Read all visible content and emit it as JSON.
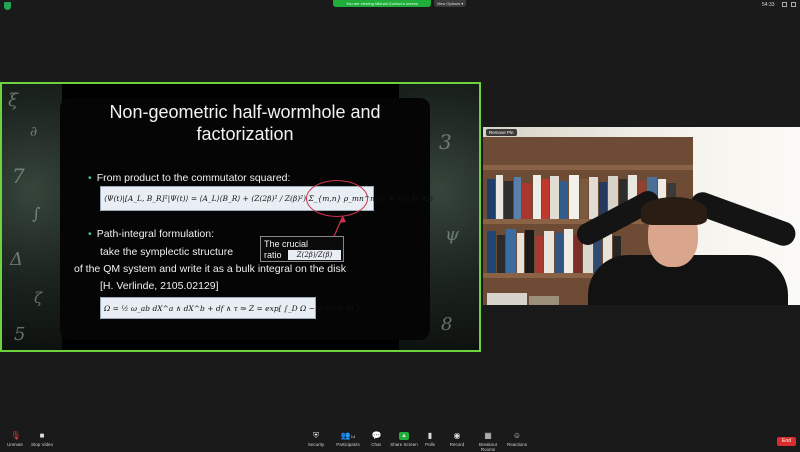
{
  "topbar": {
    "share_banner": "You are viewing Mikhail Gulinov's screen",
    "view_options": "View Options ▾",
    "clock": "54:33"
  },
  "slide": {
    "title_line1": "Non-geometric half-wormhole and",
    "title_line2": "factorization",
    "bullet1": "From product to the commutator squared:",
    "formula1": "⟨Ψ(t)|[A_L, B_R]²|Ψ(t)⟩ = ⟨A_L⟩⟨B_R⟩ + (Z(2β)² / Z(β)²) Σ_{m,n} ρ_mn^max A_mn B_mn",
    "bullet2": "Path-integral formulation:",
    "line2a": "take the symplectic structure",
    "line2b": "of the QM system and write it as a bulk integral on the disk",
    "line2c": "[H. Verlinde, 2105.02129]",
    "formula2": "Ω = ½ ω_ab dX^a ∧ dX^b + df ∧ τ ⇒ Z = exp[ ∫_D Ω − ∮_∂D H dt ]",
    "crucial_label_line1": "The crucial",
    "crucial_label_line2": "ratio",
    "crucial_formula": "Z(2β)/Z(β)"
  },
  "video": {
    "remove_pin": "Remove Pin"
  },
  "toolbar": {
    "unmute": "Unmute",
    "stop_video": "Stop Video",
    "security": "Security",
    "participants": "Participants",
    "participants_count": "14",
    "chat": "Chat",
    "share_screen": "Share Screen",
    "polls": "Polls",
    "record": "Record",
    "breakout_rooms": "Breakout Rooms",
    "reactions": "Reactions",
    "end": "End"
  },
  "colors": {
    "share_border": "#6dd33c",
    "share_banner": "#1fae3a",
    "end_button": "#d92c2c",
    "bullet": "#4dbf9e"
  }
}
